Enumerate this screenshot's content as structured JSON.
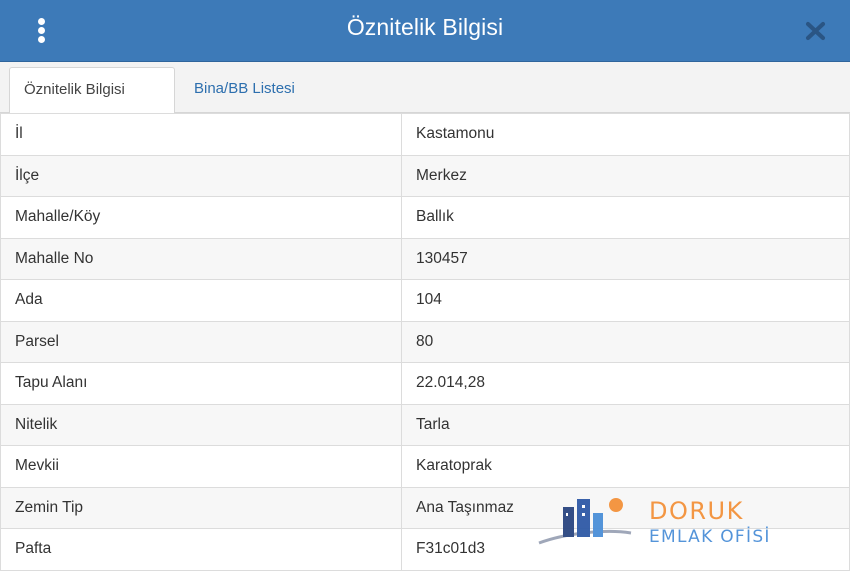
{
  "header": {
    "title": "Öznitelik Bilgisi",
    "menu_icon": "vertical-dots-icon",
    "close_icon": "close-icon",
    "color": "#3d7ab8"
  },
  "tabs": [
    {
      "label": "Öznitelik Bilgisi",
      "active": true
    },
    {
      "label": "Bina/BB Listesi",
      "active": false
    }
  ],
  "attributes": [
    {
      "key": "İl",
      "value": "Kastamonu"
    },
    {
      "key": "İlçe",
      "value": "Merkez"
    },
    {
      "key": "Mahalle/Köy",
      "value": "Ballık"
    },
    {
      "key": "Mahalle No",
      "value": "130457"
    },
    {
      "key": "Ada",
      "value": "104"
    },
    {
      "key": "Parsel",
      "value": "80"
    },
    {
      "key": "Tapu Alanı",
      "value": "22.014,28"
    },
    {
      "key": "Nitelik",
      "value": "Tarla"
    },
    {
      "key": "Mevkii",
      "value": "Karatoprak"
    },
    {
      "key": "Zemin Tip",
      "value": "Ana Taşınmaz"
    },
    {
      "key": "Pafta",
      "value": "F31c01d3"
    }
  ],
  "watermark": {
    "line1": "DORUK",
    "line2": "EMLAK OFİSİ",
    "orange": "#f3913a",
    "blue": "#4b8fd8"
  }
}
